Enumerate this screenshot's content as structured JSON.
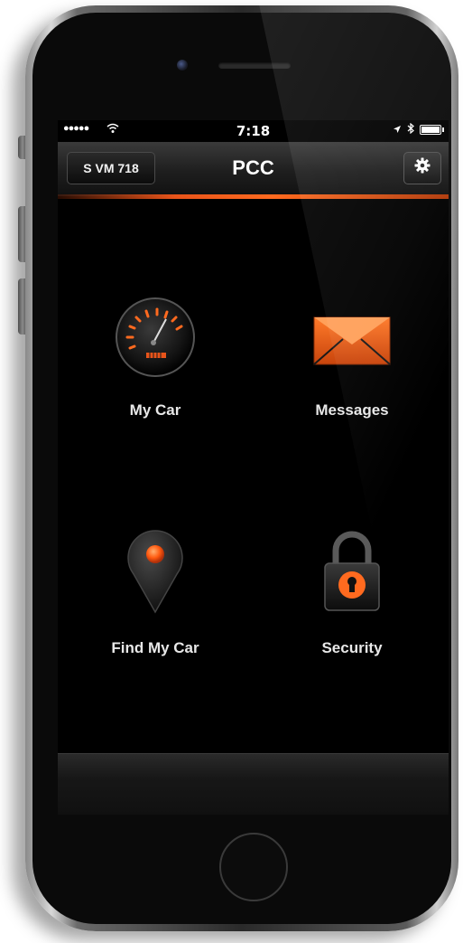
{
  "status_bar": {
    "signal": "●●●●●",
    "wifi_icon": "wifi-icon",
    "time": "7:18",
    "location_icon": "location-arrow-icon",
    "bluetooth_icon": "bluetooth-icon",
    "battery_icon": "battery-icon",
    "battery_level": 0.9
  },
  "header": {
    "vehicle_label": "S VM 718",
    "title": "PCC",
    "settings_icon": "gear-icon"
  },
  "tiles": [
    {
      "label": "My Car",
      "icon": "speedometer-icon"
    },
    {
      "label": "Messages",
      "icon": "envelope-icon"
    },
    {
      "label": "Find My Car",
      "icon": "map-pin-icon"
    },
    {
      "label": "Security",
      "icon": "padlock-icon"
    }
  ],
  "colors": {
    "accent": "#ff6a1f",
    "background": "#000000",
    "text": "#e8e8e8"
  }
}
